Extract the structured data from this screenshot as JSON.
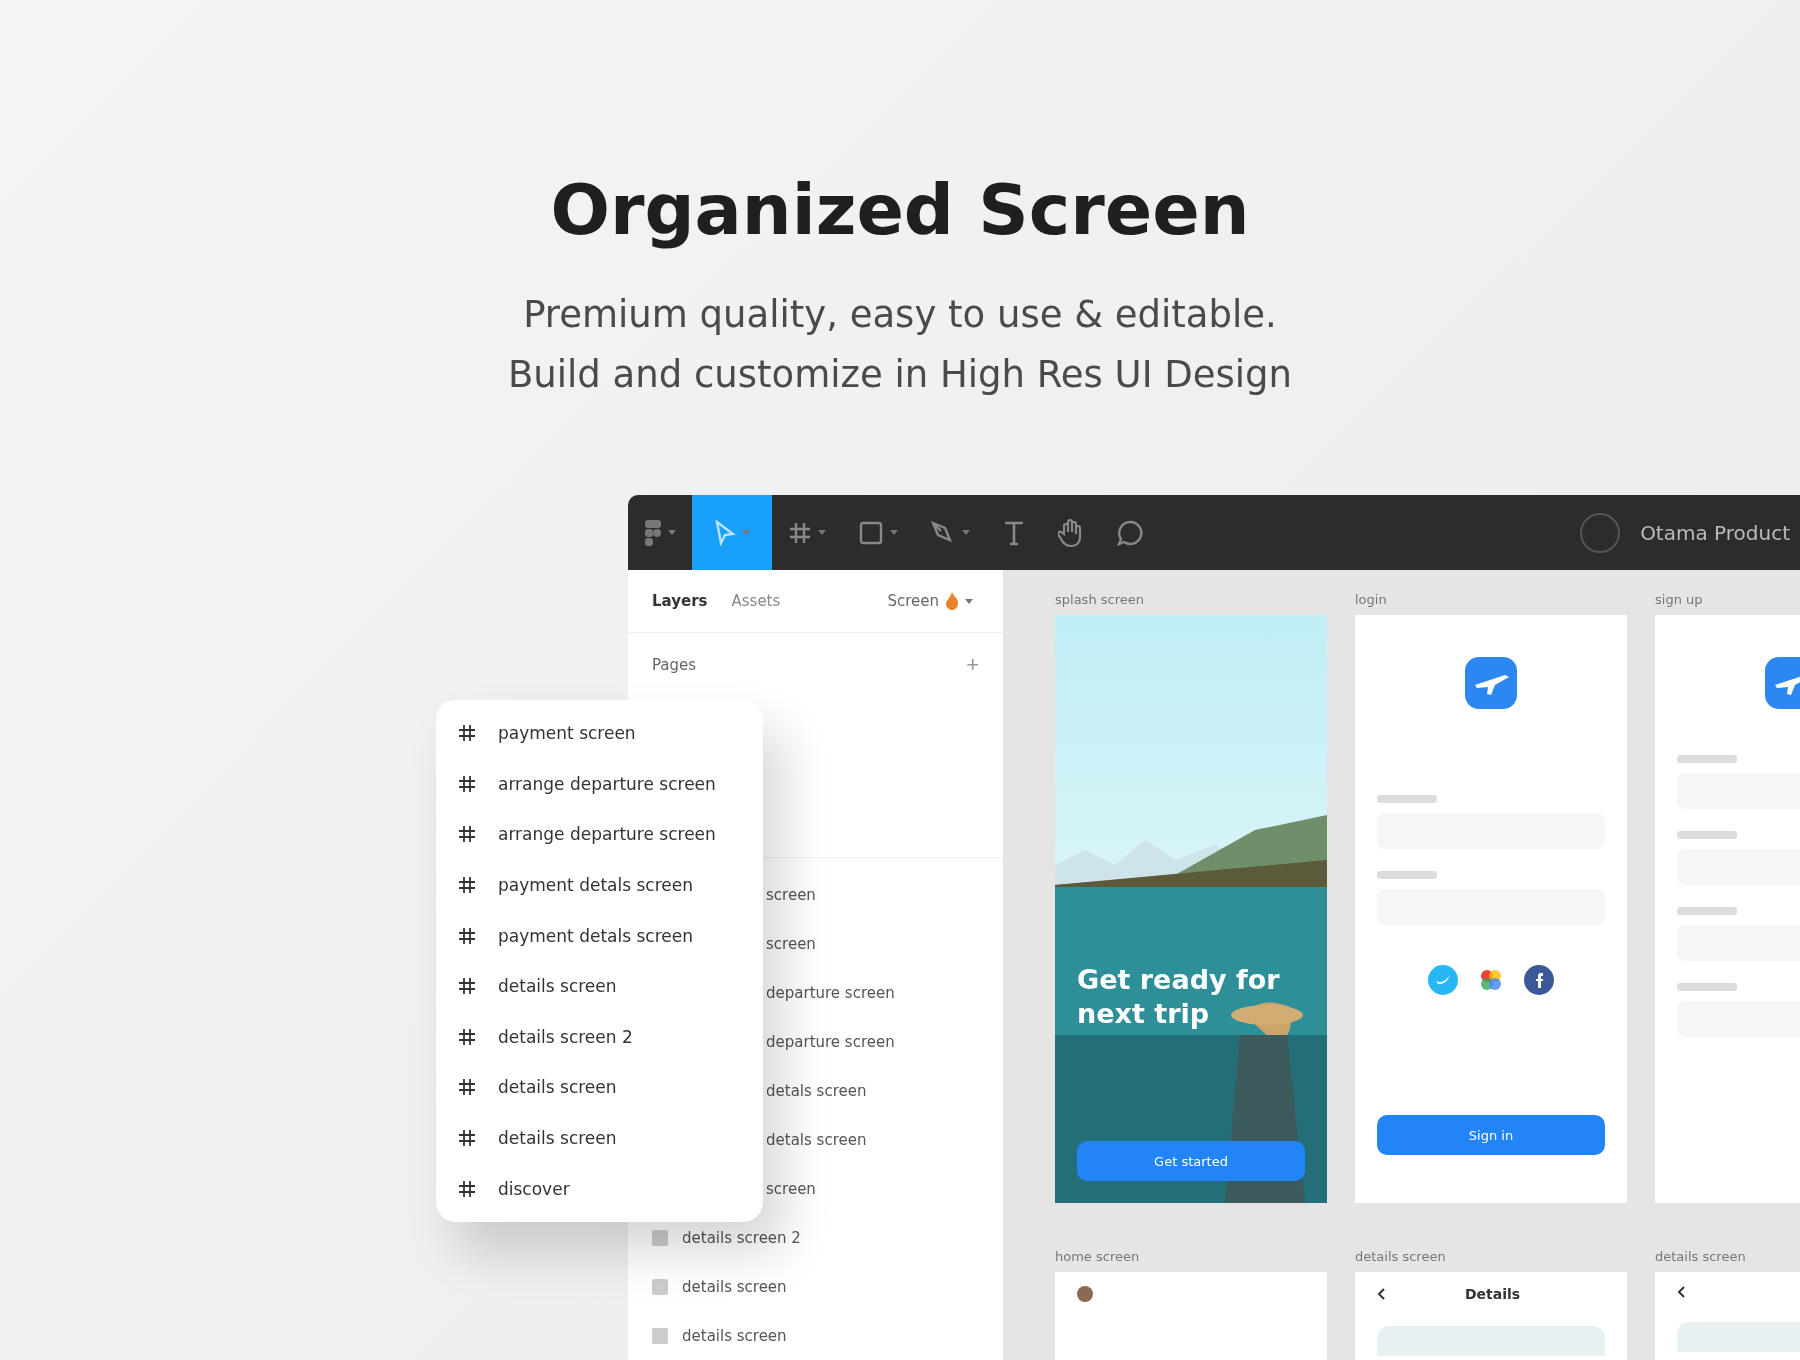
{
  "heading": "Organized Screen",
  "subtitle_lines": [
    "Premium quality, easy to use & editable.",
    "Build and customize in High Res UI Design"
  ],
  "toolbar": {
    "tools": [
      {
        "kind": "logo",
        "selected": false
      },
      {
        "kind": "move",
        "selected": true
      },
      {
        "kind": "frame",
        "selected": false
      },
      {
        "kind": "shape",
        "selected": false
      },
      {
        "kind": "pen",
        "selected": false
      },
      {
        "kind": "text",
        "selected": false
      },
      {
        "kind": "hand",
        "selected": false
      },
      {
        "kind": "comment",
        "selected": false
      }
    ],
    "file_name": "Otama Product"
  },
  "sidebar": {
    "tabs": [
      {
        "label": "Layers",
        "selected": true
      },
      {
        "label": "Assets",
        "selected": false
      }
    ],
    "page_menu": "Screen",
    "pages_title": "Pages",
    "add_page": "+",
    "layers": [
      {
        "label": "screen",
        "kind": "fragment"
      },
      {
        "label": "screen",
        "kind": "fragment"
      },
      {
        "label": "departure screen",
        "kind": "fragment"
      },
      {
        "label": "departure screen",
        "kind": "fragment"
      },
      {
        "label": "detals screen",
        "kind": "fragment"
      },
      {
        "label": "detals screen",
        "kind": "fragment"
      },
      {
        "label": "screen",
        "kind": "fragment"
      },
      {
        "label": "details screen 2",
        "kind": "frame"
      },
      {
        "label": "details screen",
        "kind": "frame"
      },
      {
        "label": "details screen",
        "kind": "frame"
      }
    ]
  },
  "canvas": {
    "frames": [
      {
        "label": "splash screen",
        "kind": "splash",
        "title": "Get ready for next trip",
        "button": "Get started"
      },
      {
        "label": "login",
        "kind": "login",
        "button": "Sign in"
      },
      {
        "label": "sign up",
        "kind": "signup"
      },
      {
        "label": "home screen",
        "kind": "home"
      },
      {
        "label": "details screen",
        "kind": "details",
        "title": "Details"
      },
      {
        "label": "details screen",
        "kind": "details"
      }
    ]
  },
  "popup": {
    "items": [
      "payment screen",
      "arrange departure screen",
      "arrange departure screen",
      "payment detals screen",
      "payment detals screen",
      "details screen",
      "details screen 2",
      "details screen",
      "details screen",
      "discover"
    ]
  }
}
